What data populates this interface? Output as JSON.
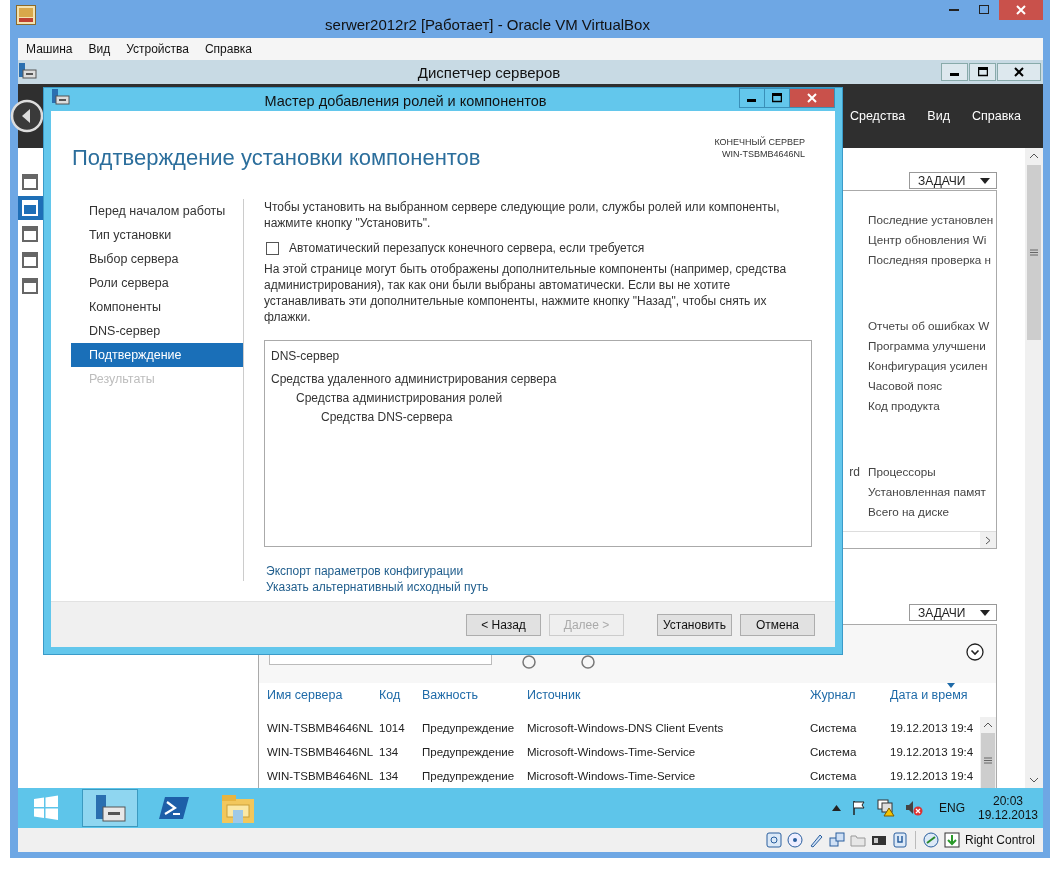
{
  "vbox_window": {
    "title": "serwer2012r2 [Работает] - Oracle VM VirtualBox",
    "menu": [
      "Машина",
      "Вид",
      "Устройства",
      "Справка"
    ]
  },
  "server_manager": {
    "title": "Диспетчер серверов",
    "header_menu": [
      "Средства",
      "Вид",
      "Справка"
    ],
    "nav": [
      {
        "selected": false
      },
      {
        "selected": true
      },
      {
        "selected": false
      },
      {
        "selected": false
      },
      {
        "selected": false
      }
    ],
    "properties": {
      "tasks_button": "ЗАДАЧИ",
      "groups": [
        {
          "items": [
            {
              "label": "Последние установлен"
            },
            {
              "label": "Центр обновления Wi"
            },
            {
              "label": "Последняя проверка н"
            }
          ]
        },
        {
          "items": [
            {
              "label": "Отчеты об ошибках W"
            },
            {
              "label": "Программа улучшени"
            },
            {
              "label": "Конфигурация усилен"
            },
            {
              "label": "Часовой пояс"
            },
            {
              "label": "Код продукта"
            }
          ]
        },
        {
          "items": [
            {
              "value": "rd",
              "label": "Процессоры"
            },
            {
              "label": "Установленная памят"
            },
            {
              "label": "Всего на диске"
            }
          ]
        }
      ]
    },
    "events": {
      "tasks_button": "ЗАДАЧИ",
      "columns": [
        "Имя сервера",
        "Код",
        "Важность",
        "Источник",
        "Журнал",
        "Дата и время"
      ],
      "rows": [
        [
          "WIN-TSBMB4646NL",
          "1014",
          "Предупреждение",
          "Microsoft-Windows-DNS Client Events",
          "Система",
          "19.12.2013 19:4"
        ],
        [
          "WIN-TSBMB4646NL",
          "134",
          "Предупреждение",
          "Microsoft-Windows-Time-Service",
          "Система",
          "19.12.2013 19:4"
        ],
        [
          "WIN-TSBMB4646NL",
          "134",
          "Предупреждение",
          "Microsoft-Windows-Time-Service",
          "Система",
          "19.12.2013 19:4"
        ]
      ]
    }
  },
  "wizard": {
    "title": "Мастер добавления ролей и компонентов",
    "heading": "Подтверждение установки компонентов",
    "target_label": "КОНЕЧНЫЙ СЕРВЕР",
    "target_server": "WIN-TSBMB4646NL",
    "steps": [
      {
        "label": "Перед началом работы",
        "selected": false,
        "disabled": false
      },
      {
        "label": "Тип установки",
        "selected": false,
        "disabled": false
      },
      {
        "label": "Выбор сервера",
        "selected": false,
        "disabled": false
      },
      {
        "label": "Роли сервера",
        "selected": false,
        "disabled": false
      },
      {
        "label": "Компоненты",
        "selected": false,
        "disabled": false
      },
      {
        "label": "DNS-сервер",
        "selected": false,
        "disabled": false
      },
      {
        "label": "Подтверждение",
        "selected": true,
        "disabled": false
      },
      {
        "label": "Результаты",
        "selected": false,
        "disabled": true
      }
    ],
    "intro": "Чтобы установить на выбранном сервере следующие роли, службы ролей или компоненты, нажмите кнопку \"Установить\".",
    "restart_checkbox": {
      "label": "Автоматический перезапуск конечного сервера, если требуется",
      "checked": false
    },
    "note": "На этой странице могут быть отображены дополнительные компоненты (например, средства администрирования), так как они были выбраны автоматически. Если вы не хотите устанавливать эти дополнительные компоненты, нажмите кнопку \"Назад\", чтобы снять их флажки.",
    "selection_tree": [
      {
        "label": "DNS-сервер"
      },
      {
        "label": "Средства удаленного администрирования сервера",
        "children": [
          {
            "label": "Средства администрирования ролей",
            "children": [
              {
                "label": "Средства DNS-сервера"
              }
            ]
          }
        ]
      }
    ],
    "links": [
      "Экспорт параметров конфигурации",
      "Указать альтернативный исходный путь"
    ],
    "buttons": [
      {
        "label": "< Назад",
        "disabled": false
      },
      {
        "label": "Далее >",
        "disabled": true
      },
      {
        "label": "Установить",
        "disabled": false
      },
      {
        "label": "Отмена",
        "disabled": false
      }
    ]
  },
  "taskbar": {
    "apps": [
      {
        "kind": "start",
        "active": false
      },
      {
        "kind": "server-manager",
        "active": true
      },
      {
        "kind": "powershell",
        "active": false
      },
      {
        "kind": "explorer",
        "active": false
      }
    ],
    "language": "ENG",
    "time": "20:03",
    "date": "19.12.2013"
  },
  "status_bar": {
    "host_key": "Right Control"
  }
}
